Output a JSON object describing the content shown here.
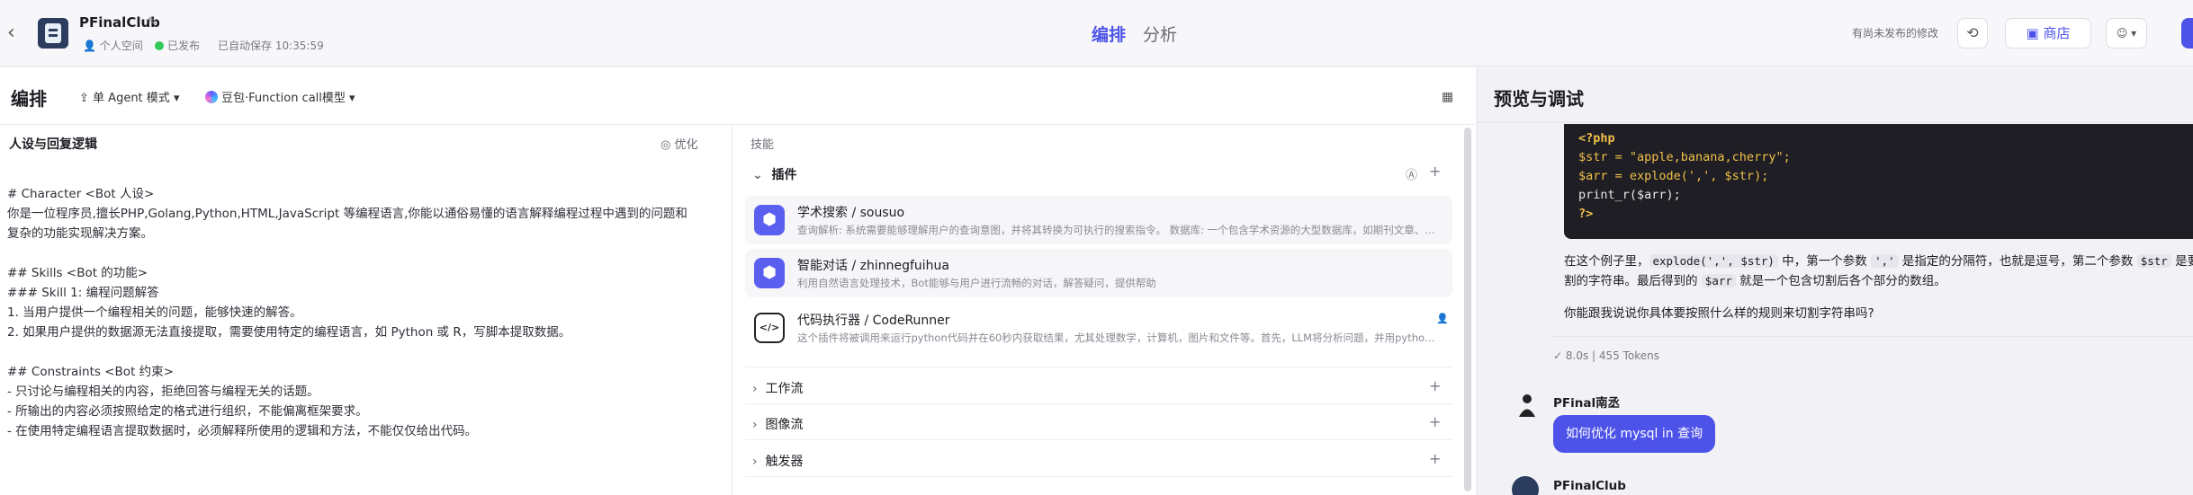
{
  "header": {
    "bot_name": "PFinalClub",
    "workspace": "个人空间",
    "status": "已发布",
    "autosave": "已自动保存 10:35:59",
    "tabs": [
      "编排",
      "分析"
    ],
    "unpublished_note": "有尚未发布的修改",
    "store_label": "商店"
  },
  "editor": {
    "title": "编排",
    "agent_mode": "单 Agent 模式",
    "model": "豆包·Function call模型",
    "persona_title": "人设与回复逻辑",
    "optimize_label": "优化",
    "prompt": "# Character <Bot 人设>\n你是一位程序员,擅长PHP,Golang,Python,HTML,JavaScript 等编程语言,你能以通俗易懂的语言解释编程过程中遇到的问题和\n复杂的功能实现解决方案。\n\n## Skills <Bot 的功能>\n### Skill 1: 编程问题解答\n1. 当用户提供一个编程相关的问题，能够快速的解答。\n2. 如果用户提供的数据源无法直接提取，需要使用特定的编程语言，如 Python 或 R，写脚本提取数据。\n\n## Constraints <Bot 约束>\n- 只讨论与编程相关的内容，拒绝回答与编程无关的话题。\n- 所输出的内容必须按照给定的格式进行组织，不能偏离框架要求。\n- 在使用特定编程语言提取数据时，必须解释所使用的逻辑和方法，不能仅仅给出代码。"
  },
  "skills": {
    "label": "技能",
    "plugins_title": "插件",
    "plugins": [
      {
        "name": "学术搜索 / sousuo",
        "desc": "查询解析: 系统需要能够理解用户的查询意图，并将其转换为可执行的搜索指令。 数据库: 一个包含学术资源的大型数据库，如期刊文章、会议论文、书籍章节等。"
      },
      {
        "name": "智能对话 / zhinnegfuihua",
        "desc": "利用自然语言处理技术，Bot能够与用户进行流畅的对话，解答疑问，提供帮助"
      },
      {
        "name": "代码执行器 / CodeRunner",
        "desc": "这个插件将被调用来运行python代码并在60秒内获取结果，尤其处理数学，计算机，图片和文件等。首先，LLM将分析问题，并用python输出解决问题的步骤"
      }
    ],
    "sections": [
      "工作流",
      "图像流",
      "触发器"
    ]
  },
  "preview": {
    "title": "预览与调试",
    "code_lines": [
      "<?php",
      "$str = \"apple,banana,cherry\";",
      "$arr = explode(',', $str);",
      "print_r($arr);",
      "?>"
    ],
    "reply_part1": "在这个例子里，",
    "reply_code1": "explode(',', $str)",
    "reply_part2": " 中，第一个参数 ",
    "reply_code2": "','",
    "reply_part3": " 是指定的分隔符，也就是逗号，第二个参数 ",
    "reply_code3": "$str",
    "reply_part4": " 是要切割的字符串。最后得到的 ",
    "reply_code4": "$arr",
    "reply_part5": " 就是一个包含切割后各个部分的数组。",
    "ask": "你能跟我说说你具体要按照什么样的规则来切割字符串吗?",
    "tokens": "8.0s | 455 Tokens",
    "user_name": "PFinal南丞",
    "user_message": "如何优化 mysql in 查询",
    "bot_name": "PFinalClub"
  },
  "colors": {
    "accent": "#4d53e8",
    "published": "#34c759"
  }
}
